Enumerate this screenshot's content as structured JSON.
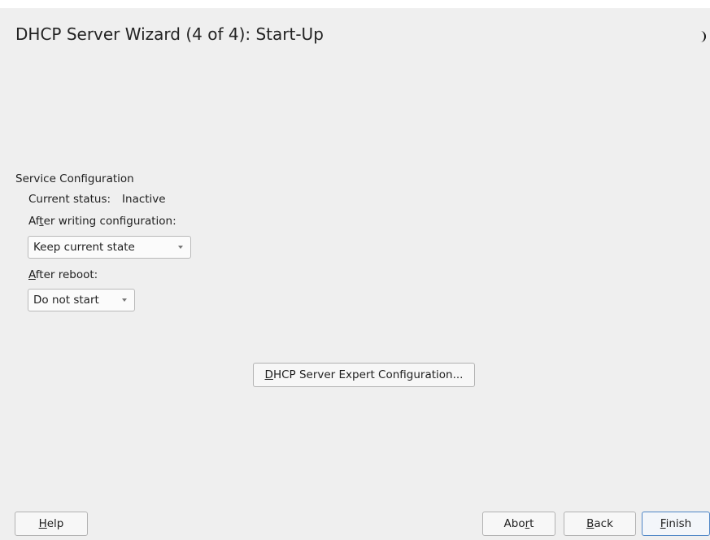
{
  "dialog": {
    "title": "DHCP Server Wizard (4 of 4): Start-Up"
  },
  "service": {
    "section_title": "Service Configuration",
    "status_label": "Current status:",
    "status_value": "Inactive",
    "after_writing": {
      "label_prefix": "Af",
      "label_mnemonic": "t",
      "label_suffix": "er writing configuration:",
      "selected": "Keep current state"
    },
    "after_reboot": {
      "label_prefix": "",
      "label_mnemonic": "A",
      "label_suffix": "fter reboot:",
      "selected": "Do not start"
    }
  },
  "expert_button": {
    "mnemonic": "D",
    "rest": "HCP Server Expert Configuration..."
  },
  "footer": {
    "help": {
      "prefix": "",
      "mnemonic": "H",
      "suffix": "elp"
    },
    "abort": {
      "prefix": "Abo",
      "mnemonic": "r",
      "suffix": "t"
    },
    "back": {
      "prefix": "",
      "mnemonic": "B",
      "suffix": "ack"
    },
    "finish": {
      "prefix": "",
      "mnemonic": "F",
      "suffix": "inish"
    }
  },
  "icons": {
    "moon": "moon-icon"
  }
}
